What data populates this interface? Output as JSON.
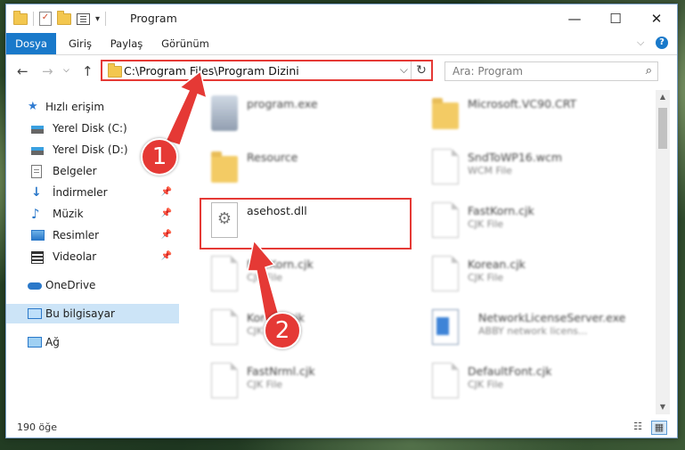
{
  "window": {
    "title": "Program",
    "controls": {
      "minimize": "—",
      "maximize": "☐",
      "close": "✕"
    }
  },
  "ribbon": {
    "tabs": [
      "Dosya",
      "Giriş",
      "Paylaş",
      "Görünüm"
    ],
    "expand_icon": "chevron-down-icon",
    "help_label": "?"
  },
  "navigation": {
    "address_path": "C:\\Program Files\\Program Dizini",
    "search_placeholder": "Ara: Program"
  },
  "sidebar": {
    "items": [
      {
        "label": "Hızlı erişim",
        "icon": "star-icon"
      },
      {
        "label": "Yerel Disk (C:)",
        "icon": "disk-icon"
      },
      {
        "label": "Yerel Disk (D:)",
        "icon": "disk-icon"
      },
      {
        "label": "Belgeler",
        "icon": "documents-icon",
        "pinned": true
      },
      {
        "label": "İndirmeler",
        "icon": "downloads-icon",
        "pinned": true
      },
      {
        "label": "Müzik",
        "icon": "music-icon",
        "pinned": true
      },
      {
        "label": "Resimler",
        "icon": "pictures-icon",
        "pinned": true
      },
      {
        "label": "Videolar",
        "icon": "videos-icon",
        "pinned": true
      },
      {
        "label": "OneDrive",
        "icon": "onedrive-icon"
      },
      {
        "label": "Bu bilgisayar",
        "icon": "this-pc-icon",
        "selected": true
      },
      {
        "label": "Ağ",
        "icon": "network-icon"
      }
    ]
  },
  "files": [
    {
      "name": "program.exe",
      "sub": "",
      "type": "exe"
    },
    {
      "name": "Microsoft.VC90.CRT",
      "sub": "",
      "type": "folder"
    },
    {
      "name": "Resource",
      "sub": "",
      "type": "folder"
    },
    {
      "name": "SndToWP16.wcm",
      "sub": "WCM File",
      "type": "file"
    },
    {
      "name": "asehost.dll",
      "sub": "",
      "type": "dll"
    },
    {
      "name": "FastKorn.cjk",
      "sub": "CJK File",
      "type": "file"
    },
    {
      "name": "FastKorn.cjk",
      "sub": "CJK File",
      "type": "file"
    },
    {
      "name": "Korean.cjk",
      "sub": "CJK File",
      "type": "file"
    },
    {
      "name": "Korean.cjk",
      "sub": "CJK File",
      "type": "file"
    },
    {
      "name": "NetworkLicenseServer.exe",
      "sub": "ABBY network licens...",
      "type": "netexe"
    },
    {
      "name": "FastNrml.cjk",
      "sub": "CJK File",
      "type": "file"
    },
    {
      "name": "DefaultFont.cjk",
      "sub": "CJK File",
      "type": "file"
    }
  ],
  "status": {
    "count": "190 öğe"
  },
  "annotations": {
    "callout_1": "1",
    "callout_2": "2"
  },
  "colors": {
    "accent": "#1979ca",
    "highlight": "#e53935",
    "selection": "#cce4f7"
  }
}
